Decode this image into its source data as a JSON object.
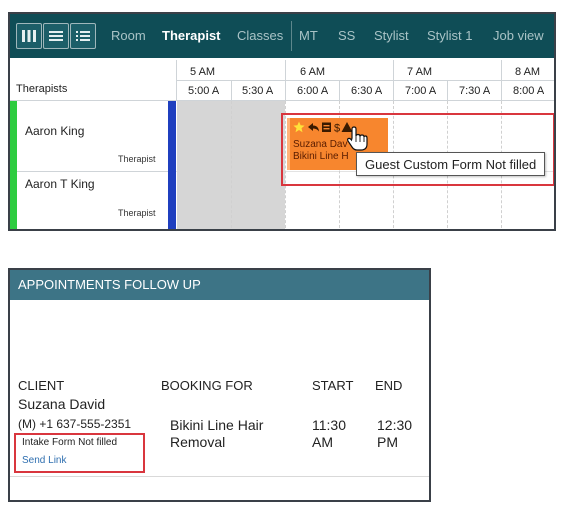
{
  "toolbar": {
    "view_buttons": [
      {
        "icon": "columns-view-icon"
      },
      {
        "icon": "list-view-icon"
      },
      {
        "icon": "detail-list-view-icon"
      }
    ],
    "tabs": [
      "Room",
      "Therapist",
      "Classes",
      "MT",
      "SS",
      "Stylist",
      "Stylist 1",
      "Job view"
    ],
    "active_tab": "Therapist"
  },
  "schedule": {
    "resource_header": "Therapists",
    "hours": [
      "5 AM",
      "6 AM",
      "7 AM",
      "8 AM"
    ],
    "slots": [
      "5:00 A",
      "5:30 A",
      "6:00 A",
      "6:30 A",
      "7:00 A",
      "7:30 A",
      "8:00 A"
    ],
    "therapists": [
      {
        "name": "Aaron King",
        "role": "Therapist"
      },
      {
        "name": "Aaron T King",
        "role": "Therapist"
      }
    ],
    "appointment": {
      "client": "Suzana David",
      "service": "Bikini Line Hair Removal",
      "line1": "Suzana Dav",
      "line2": "Bikini Line H",
      "icons": [
        "star-icon",
        "reply-icon",
        "register-icon",
        "dollar-icon",
        "warning-icon"
      ],
      "icon_text": "$"
    },
    "tooltip": "Guest Custom Form Not filled"
  },
  "follow_up": {
    "title": "APPOINTMENTS FOLLOW UP",
    "columns": [
      "CLIENT",
      "BOOKING FOR",
      "START",
      "END"
    ],
    "row": {
      "client": "Suzana David",
      "phone": "(M) +1 637-555-2351",
      "form_status": "Intake Form Not filled",
      "action": "Send Link",
      "booking_line1": "Bikini Line Hair",
      "booking_line2": "Removal",
      "start_line1": "11:30",
      "start_line2": "AM",
      "end_line1": "12:30",
      "end_line2": "PM"
    }
  },
  "colors": {
    "toolbar_bg": "#0f4d56",
    "panel_header_bg": "#3d7486",
    "appointment": "#f7862e",
    "highlight": "#d9363e",
    "therapist_accent": "#2ecc40",
    "resource_bar": "#1f3fbf",
    "link": "#2f6fb0"
  }
}
